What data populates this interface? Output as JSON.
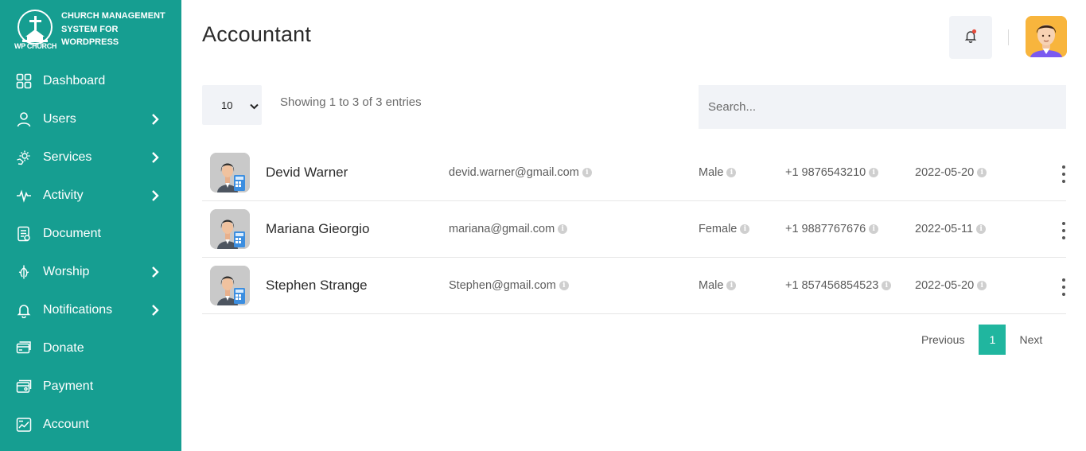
{
  "brand": {
    "line1": "CHURCH MANAGEMENT",
    "line2": "SYSTEM FOR",
    "line3": "WORDPRESS",
    "logo_text": "WP CHURCH"
  },
  "sidebar": {
    "items": [
      {
        "label": "Dashboard",
        "icon": "grid-icon",
        "has_submenu": false
      },
      {
        "label": "Users",
        "icon": "user-icon",
        "has_submenu": true
      },
      {
        "label": "Services",
        "icon": "gear-hand-icon",
        "has_submenu": true
      },
      {
        "label": "Activity",
        "icon": "pulse-icon",
        "has_submenu": true
      },
      {
        "label": "Document",
        "icon": "document-icon",
        "has_submenu": false
      },
      {
        "label": "Worship",
        "icon": "worship-icon",
        "has_submenu": true
      },
      {
        "label": "Notifications",
        "icon": "bell-icon",
        "has_submenu": true
      },
      {
        "label": "Donate",
        "icon": "donate-icon",
        "has_submenu": false
      },
      {
        "label": "Payment",
        "icon": "payment-icon",
        "has_submenu": false
      },
      {
        "label": "Account",
        "icon": "account-icon",
        "has_submenu": false
      }
    ]
  },
  "header": {
    "title": "Accountant"
  },
  "controls": {
    "page_length": "10",
    "info": "Showing 1 to 3 of 3 entries",
    "search_placeholder": "Search..."
  },
  "table": {
    "rows": [
      {
        "name": "Devid Warner",
        "email": "devid.warner@gmail.com",
        "gender": "Male",
        "phone": "+1 9876543210",
        "date": "2022-05-20"
      },
      {
        "name": "Mariana Gieorgio",
        "email": "mariana@gmail.com",
        "gender": "Female",
        "phone": "+1 9887767676",
        "date": "2022-05-11"
      },
      {
        "name": "Stephen Strange",
        "email": "Stephen@gmail.com",
        "gender": "Male",
        "phone": "+1 857456854523",
        "date": "2022-05-20"
      }
    ]
  },
  "pagination": {
    "prev": "Previous",
    "current": "1",
    "next": "Next"
  },
  "colors": {
    "sidebar": "#169e91",
    "accent": "#20b69f",
    "panel": "#f1f3f7",
    "notification_dot": "#e74c3c"
  }
}
